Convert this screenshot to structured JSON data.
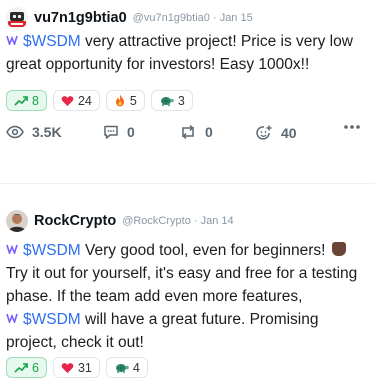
{
  "posts": [
    {
      "username": "vu7n1g9btia0",
      "handle": "@vu7n1g9btia0",
      "date": "Jan 15",
      "avatar_icon": "robot-badge-avatar",
      "body": {
        "cashtag": "$WSDM",
        "text": " very attractive project! Price is very low great opportunity for investors! Easy 1000x!!"
      },
      "reactions": [
        {
          "icon": "trending-up-icon",
          "count": "8",
          "active": true
        },
        {
          "icon": "heart-icon",
          "count": "24",
          "active": false
        },
        {
          "icon": "fire-icon",
          "count": "5",
          "active": false
        },
        {
          "icon": "turtle-icon",
          "count": "3",
          "active": false
        }
      ],
      "actions": {
        "views": "3.5K",
        "comments": "0",
        "reposts": "0",
        "reactions": "40"
      }
    },
    {
      "username": "RockCrypto",
      "handle": "@RockCrypto",
      "date": "Jan 14",
      "avatar_icon": "person-avatar",
      "body": {
        "cashtag1": "$WSDM",
        "text1": " Very good tool, even for beginners! ",
        "text2": "Try it out for yourself, it's easy and free for a testing phase. If the team add even more features, ",
        "cashtag2": "$WSDM",
        "text3": " will have a great future. Promising project, check it out!"
      },
      "reactions": [
        {
          "icon": "trending-up-icon",
          "count": "6",
          "active": true
        },
        {
          "icon": "heart-icon",
          "count": "31",
          "active": false
        },
        {
          "icon": "turtle-icon",
          "count": "4",
          "active": false
        }
      ]
    }
  ],
  "colors": {
    "cashtag": "#2f6fef",
    "bullish_bg": "#e7f8ee",
    "bullish_text": "#16a34a",
    "heart": "#e8264a"
  }
}
